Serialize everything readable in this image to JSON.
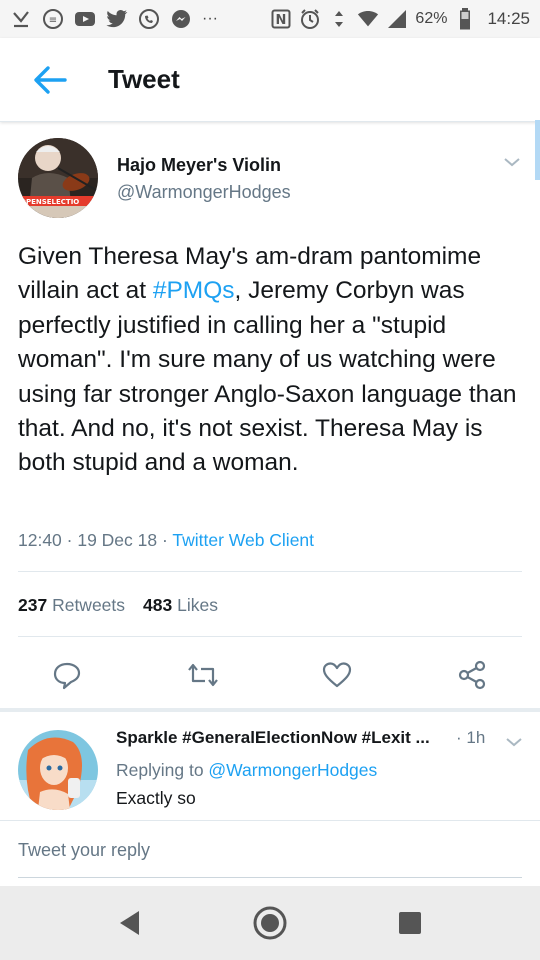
{
  "status_bar": {
    "battery_percent": "62%",
    "time": "14:25",
    "nfc_label": "N",
    "overflow": "···"
  },
  "app_bar": {
    "title": "Tweet"
  },
  "tweet": {
    "author_name": "Hajo Meyer's Violin",
    "author_handle": "@WarmongerHodges",
    "avatar_badge": "OPENSELECTIO",
    "text_before_hashtag": "Given Theresa May's am-dram pantomime villain act at ",
    "hashtag": "#PMQs",
    "text_after_hashtag": ", Jeremy Corbyn was perfectly justified in calling her a \"stupid woman\". I'm sure many of us watching were using far stronger Anglo-Saxon language than that. And no, it's not sexist. Theresa May is both stupid and a woman.",
    "timestamp": "12:40 · 19 Dec 18 · ",
    "client": "Twitter Web Client",
    "retweets_count": "237",
    "retweets_label": "Retweets",
    "likes_count": "483",
    "likes_label": "Likes"
  },
  "reply": {
    "author_name": "Sparkle #GeneralElectionNow #Lexit ...",
    "time": "· 1h",
    "replying_prefix": "Replying to ",
    "replying_to": "@WarmongerHodges",
    "text": "Exactly so"
  },
  "reply_box": {
    "placeholder": "Tweet your reply"
  },
  "colors": {
    "accent": "#1da1f2",
    "secondary_text": "#657786",
    "divider": "#e1e8ed"
  }
}
